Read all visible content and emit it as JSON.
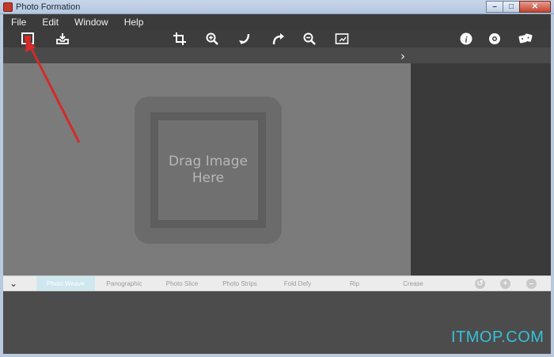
{
  "window": {
    "title": "Photo Formation",
    "minimize": "–",
    "maximize": "□",
    "close": "✕"
  },
  "menu": [
    "File",
    "Edit",
    "Window",
    "Help"
  ],
  "toolbar": {
    "icons": [
      "open-image-icon",
      "save-icon",
      "crop-icon",
      "zoom-in-icon",
      "rotate-left-icon",
      "rotate-right-icon",
      "zoom-out-icon",
      "fit-screen-icon",
      "info-icon",
      "settings-icon",
      "random-dice-icon"
    ]
  },
  "substrip": {
    "expand_glyph": "›"
  },
  "canvas": {
    "drop_text": "Drag Image Here"
  },
  "tabs": {
    "collapse_glyph": "⌄",
    "items": [
      "Photo Weave",
      "Panographic",
      "Photo Slice",
      "Photo Strips",
      "Fold Defy",
      "Rip",
      "Crease"
    ],
    "active": "Photo Weave",
    "controls": {
      "reset": "↺",
      "add": "+",
      "remove": "–"
    }
  },
  "watermark": "ITMOP.COM",
  "colors": {
    "annotation_arrow": "#d42a2a",
    "watermark": "#35c1d9",
    "active_tab": "#cfe8ef"
  }
}
